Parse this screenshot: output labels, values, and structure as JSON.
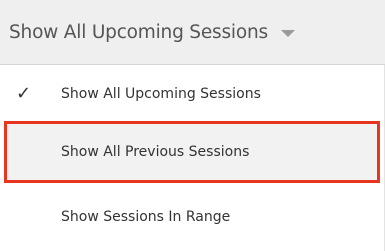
{
  "dropdown": {
    "selected_label": "Show All Upcoming Sessions",
    "caret_icon": "caret-down-icon",
    "options": [
      {
        "label": "Show All Upcoming Sessions",
        "checked": true,
        "check_glyph": "✓"
      },
      {
        "label": "Show All Previous Sessions",
        "checked": false,
        "highlighted": true
      },
      {
        "label": "Show Sessions In Range",
        "checked": false
      }
    ]
  },
  "colors": {
    "trigger_background": "#efefef",
    "highlight_border": "#e8351f",
    "highlight_background": "#f2f2f2",
    "text": "#333333"
  }
}
